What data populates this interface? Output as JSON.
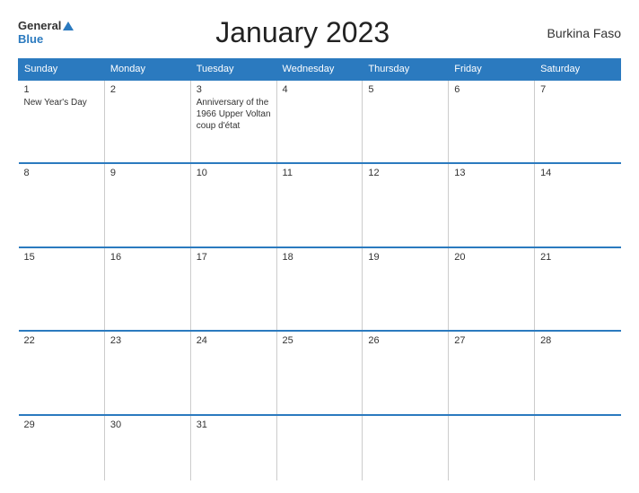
{
  "logo": {
    "general": "General",
    "blue": "Blue"
  },
  "title": "January 2023",
  "country": "Burkina Faso",
  "days_of_week": [
    "Sunday",
    "Monday",
    "Tuesday",
    "Wednesday",
    "Thursday",
    "Friday",
    "Saturday"
  ],
  "weeks": [
    [
      {
        "day": "1",
        "event": "New Year's Day"
      },
      {
        "day": "2",
        "event": ""
      },
      {
        "day": "3",
        "event": "Anniversary of the 1966 Upper Voltan coup d'état"
      },
      {
        "day": "4",
        "event": ""
      },
      {
        "day": "5",
        "event": ""
      },
      {
        "day": "6",
        "event": ""
      },
      {
        "day": "7",
        "event": ""
      }
    ],
    [
      {
        "day": "8",
        "event": ""
      },
      {
        "day": "9",
        "event": ""
      },
      {
        "day": "10",
        "event": ""
      },
      {
        "day": "11",
        "event": ""
      },
      {
        "day": "12",
        "event": ""
      },
      {
        "day": "13",
        "event": ""
      },
      {
        "day": "14",
        "event": ""
      }
    ],
    [
      {
        "day": "15",
        "event": ""
      },
      {
        "day": "16",
        "event": ""
      },
      {
        "day": "17",
        "event": ""
      },
      {
        "day": "18",
        "event": ""
      },
      {
        "day": "19",
        "event": ""
      },
      {
        "day": "20",
        "event": ""
      },
      {
        "day": "21",
        "event": ""
      }
    ],
    [
      {
        "day": "22",
        "event": ""
      },
      {
        "day": "23",
        "event": ""
      },
      {
        "day": "24",
        "event": ""
      },
      {
        "day": "25",
        "event": ""
      },
      {
        "day": "26",
        "event": ""
      },
      {
        "day": "27",
        "event": ""
      },
      {
        "day": "28",
        "event": ""
      }
    ],
    [
      {
        "day": "29",
        "event": ""
      },
      {
        "day": "30",
        "event": ""
      },
      {
        "day": "31",
        "event": ""
      },
      {
        "day": "",
        "event": ""
      },
      {
        "day": "",
        "event": ""
      },
      {
        "day": "",
        "event": ""
      },
      {
        "day": "",
        "event": ""
      }
    ]
  ],
  "colors": {
    "header_bg": "#2b7abf",
    "border": "#2b7abf",
    "text": "#333333"
  }
}
